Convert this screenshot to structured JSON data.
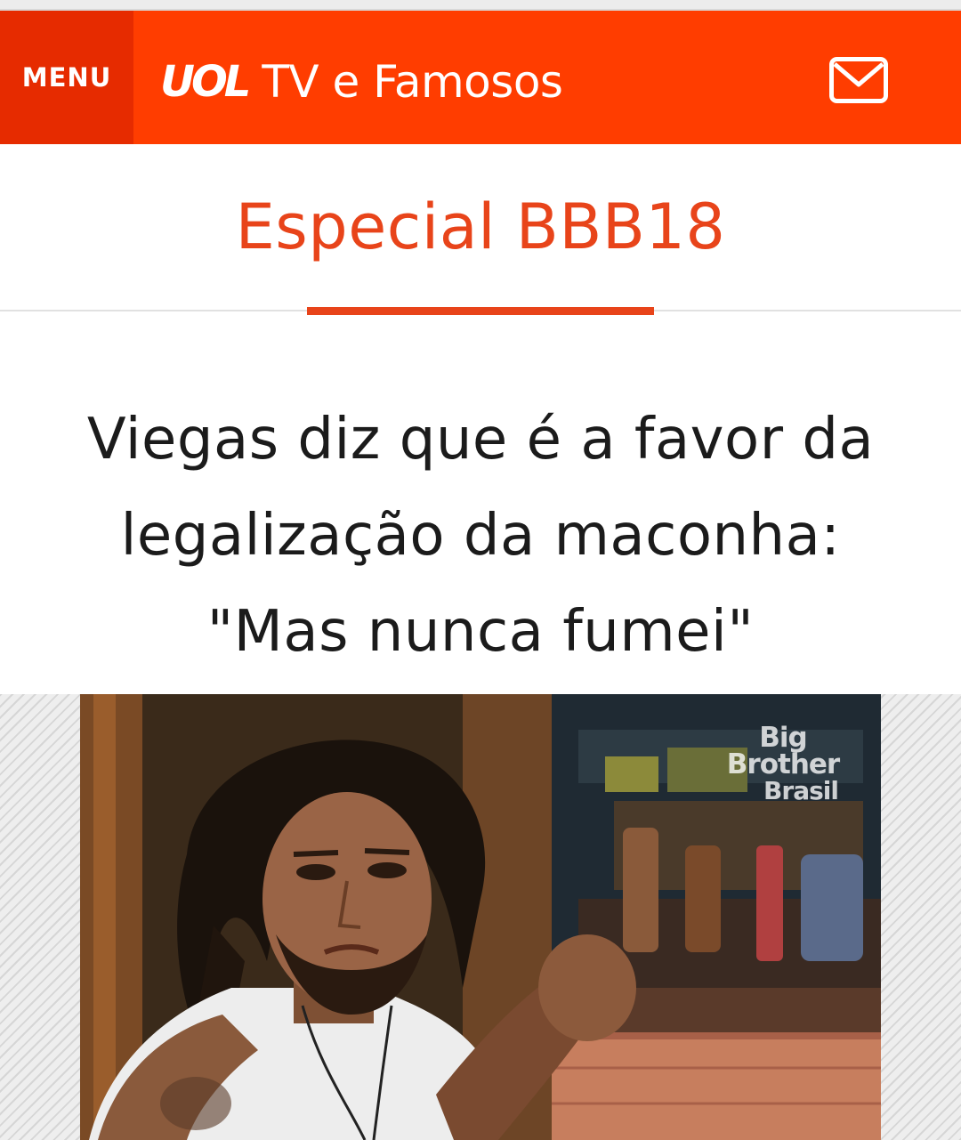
{
  "header": {
    "menu_label": "MENU",
    "brand_logo": "UOL",
    "brand_section": "TV e Famosos",
    "mail_icon": "envelope-icon",
    "colors": {
      "bar": "#ff3d00",
      "menu_bg": "#e62b00",
      "text": "#ffffff"
    }
  },
  "section": {
    "title": "Especial BBB18",
    "accent_color": "#e8441a"
  },
  "article": {
    "headline_lines": [
      "Viegas diz que é a favor da",
      "legalização da maconha:",
      "\"Mas nunca fumei\""
    ]
  },
  "media": {
    "watermark_line1": "Big Brother",
    "watermark_line2": "Brasil"
  }
}
